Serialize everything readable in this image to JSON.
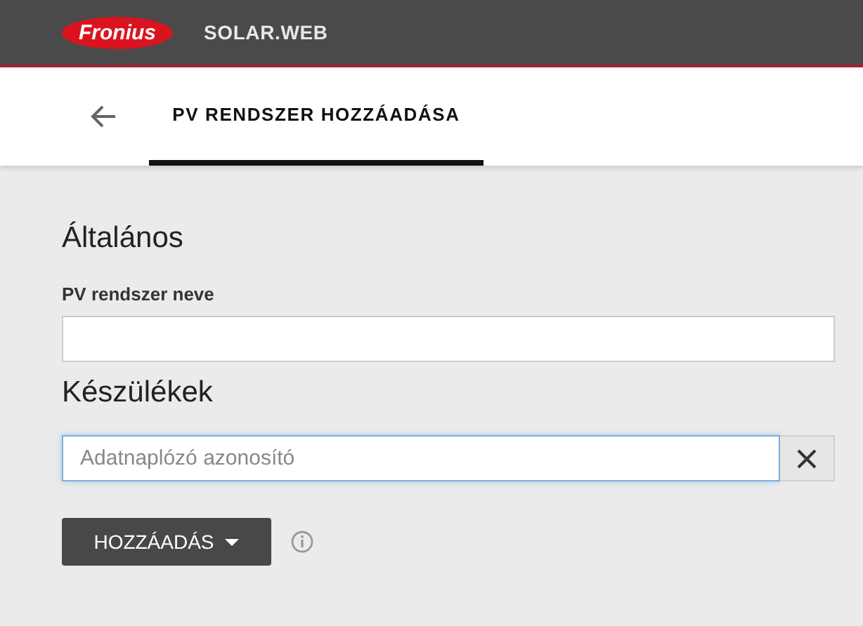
{
  "header": {
    "logo": "Fronius",
    "app_name": "SOLAR.WEB"
  },
  "tab_bar": {
    "tabs": [
      {
        "label": "PV RENDSZER HOZZÁADÁSA",
        "selected": true
      }
    ]
  },
  "sections": [
    {
      "title": "Általános",
      "field": {
        "label": "PV rendszer neve",
        "focused": false
      }
    },
    {
      "title": "Készülékek",
      "field": {
        "placeholder": "Adatnaplózó azonosító",
        "focused": true,
        "clearable": true
      }
    }
  ],
  "add_button": {
    "label": "HOZZÁADÁS"
  }
}
